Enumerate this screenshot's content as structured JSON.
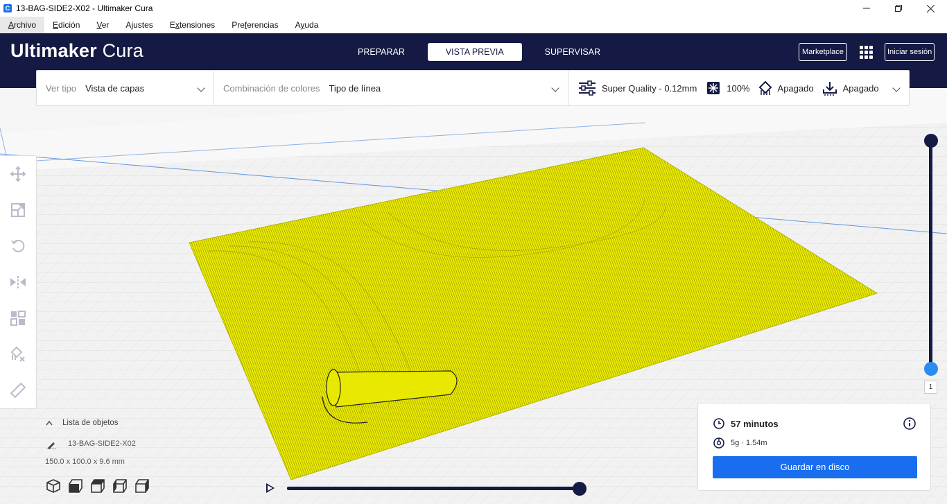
{
  "window": {
    "title": "13-BAG-SIDE2-X02 - Ultimaker Cura",
    "app_icon": "C"
  },
  "menu": [
    {
      "label": "Archivo",
      "accel": "A",
      "rest": "rchivo"
    },
    {
      "label": "Edición",
      "accel": "E",
      "rest": "dición"
    },
    {
      "label": "Ver",
      "accel": "V",
      "rest": "er"
    },
    {
      "label": "Ajustes",
      "accel": "j",
      "pre": "A",
      "rest": "ustes"
    },
    {
      "label": "Extensiones",
      "accel": "x",
      "pre": "E",
      "rest": "tensiones"
    },
    {
      "label": "Preferencias",
      "accel": "f",
      "pre": "Pre",
      "rest": "erencias"
    },
    {
      "label": "Ayuda",
      "accel": "y",
      "pre": "A",
      "rest": "uda"
    }
  ],
  "header": {
    "logo_strong": "Ultimaker",
    "logo_light": "Cura",
    "stages": [
      "PREPARAR",
      "VISTA PREVIA",
      "SUPERVISAR"
    ],
    "active_stage": "VISTA PREVIA",
    "marketplace": "Marketplace",
    "login": "Iniciar sesión"
  },
  "settings_bar": {
    "view_type_label": "Ver tipo",
    "view_type_value": "Vista de capas",
    "color_scheme_label": "Combinación de colores",
    "color_scheme_value": "Tipo de línea",
    "profile": "Super Quality - 0.12mm",
    "infill": "100%",
    "support": "Apagado",
    "adhesion": "Apagado"
  },
  "objects": {
    "header": "Lista de objetos",
    "name": "13-BAG-SIDE2-X02",
    "dimensions": "150.0 x 100.0 x 9.6 mm"
  },
  "layer_slider": {
    "current_layer": "1"
  },
  "print_info": {
    "time": "57 minutos",
    "material": "5g · 1.54m",
    "save_button": "Guardar en disco"
  },
  "colors": {
    "header_bg": "#141a44",
    "accent": "#196ef0",
    "model_yellow": "#e6e600"
  }
}
